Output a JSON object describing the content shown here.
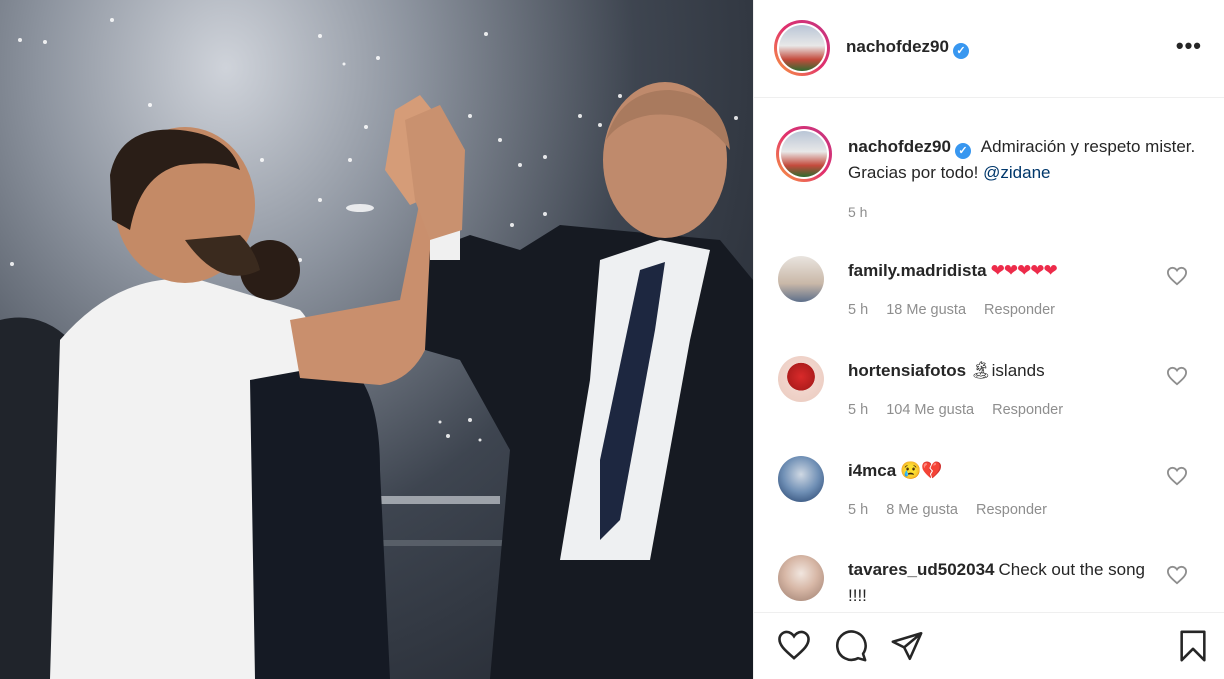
{
  "post": {
    "username": "nachofdez90",
    "verified": true,
    "caption_text": "Admiración y respeto mister. Gracias por todo!",
    "caption_mention": "@zidane",
    "time": "5 h"
  },
  "comments": [
    {
      "username": "family.madridista",
      "text": "",
      "emoji": "❤❤❤❤❤",
      "time": "5 h",
      "likes": "18 Me gusta",
      "reply": "Responder"
    },
    {
      "username": "hortensiafotos",
      "text": "islands",
      "emoji": "🏝",
      "time": "5 h",
      "likes": "104 Me gusta",
      "reply": "Responder"
    },
    {
      "username": "i4mca",
      "text": "",
      "emoji": "😢💔",
      "time": "5 h",
      "likes": "8 Me gusta",
      "reply": "Responder"
    },
    {
      "username": "tavares_ud502034",
      "text": "Check out the song !!!!",
      "emoji": "",
      "time": "",
      "likes": "",
      "reply": ""
    }
  ],
  "colors": {
    "verified": "#3897f0",
    "secondary_text": "#8e8e8e",
    "mention": "#00376b",
    "story_ring_start": "#f9a03f",
    "story_ring_end": "#c13584"
  },
  "icons": {
    "more": "more-options-icon",
    "like": "heart-icon",
    "comment": "comment-icon",
    "share": "share-icon",
    "save": "bookmark-icon"
  }
}
